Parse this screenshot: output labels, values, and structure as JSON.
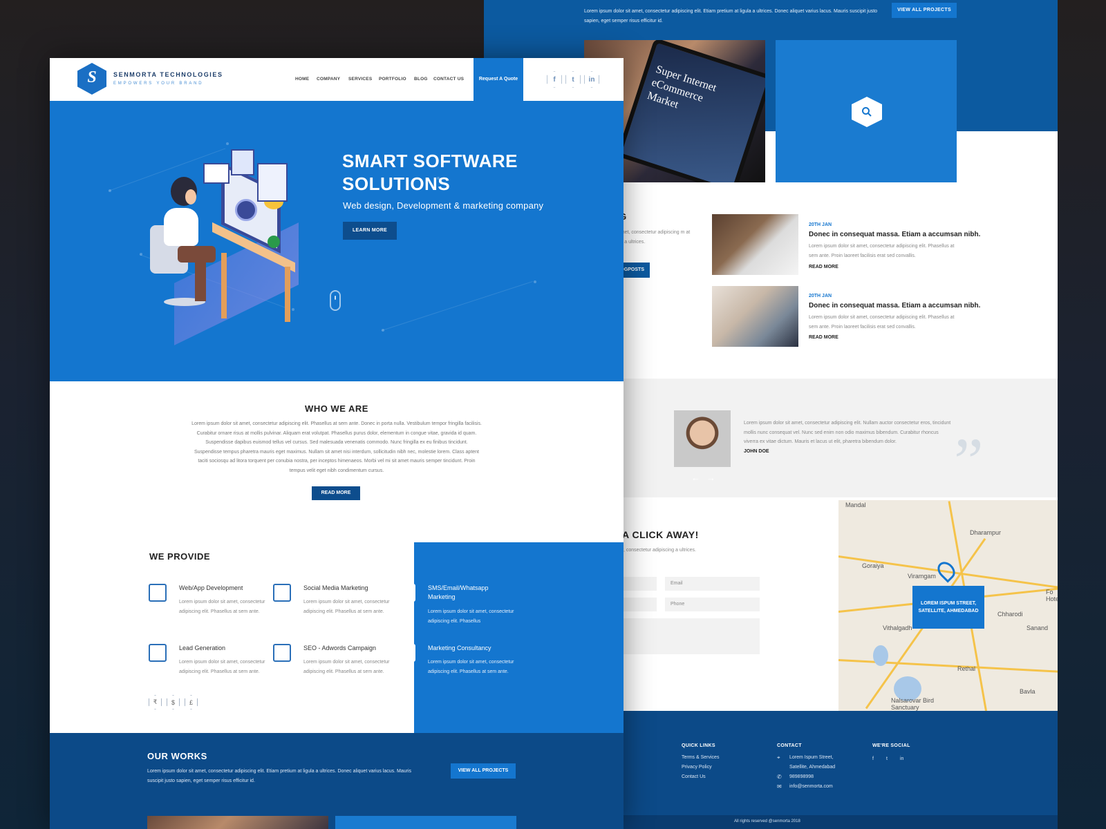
{
  "back": {
    "works_text": "Lorem ipsum dolor sit amet, consectetur adipiscing elit. Etiam pretium at ligula a ultrices. Donec aliquet varius lacus. Mauris suscipit justo sapien, eget semper risus efficitur id.",
    "view_all_projects": "VIEW ALL PROJECTS",
    "project_card_text": "Super Internet eCommerce Market",
    "blog": {
      "heading": "OG",
      "intro": "sit amet, consectetur adipiscing m at ligula a ultrices.",
      "button": "OGPOSTS",
      "posts": [
        {
          "date": "20TH JAN",
          "title": "Donec in consequat massa. Etiam a accumsan nibh.",
          "text": "Lorem ipsum dolor sit amet, consectetur adipiscing elit. Phasellus at sem ante. Proin laoreet facilisis erat sed convallis.",
          "more": "READ MORE"
        },
        {
          "date": "20TH JAN",
          "title": "Donec in consequat massa. Etiam a accumsan nibh.",
          "text": "Lorem ipsum dolor sit amet, consectetur adipiscing elit. Phasellus at sem ante. Proin laoreet facilisis erat sed convallis.",
          "more": "READ MORE"
        }
      ]
    },
    "testimonial": {
      "text": "Lorem ipsum dolor sit amet, consectetur adipiscing elit. Nullam auctor consectetur eros, tincidunt mollis nunc consequat vel. Nunc sed enim non odio maximus bibendum. Curabitur rhoncus viverra ex vitae dictum. Mauris et lacus ut elit, pharetra bibendum dolor.",
      "name": "JOHN DOE",
      "prev": "←",
      "next": "→"
    },
    "contact": {
      "heading": "A CLICK AWAY!",
      "text": "r, consectetur adipiscing a ultrices.",
      "email_placeholder": "Email",
      "phone_placeholder": "Phone"
    },
    "map": {
      "labels": [
        "Mandal",
        "Dharampur",
        "Goraiya",
        "Viramgam",
        "Vithalgadh",
        "Chharodi",
        "Sanand",
        "Rethal",
        "Bavla",
        "Nalsarovar Bird Sanctuary",
        "Fo Hote"
      ],
      "popup_line1": "LOREM ISPUM STREET,",
      "popup_line2": "SATELLITE, AHMEDABAD"
    },
    "footer": {
      "quick_links_heading": "QUICK LINKS",
      "links": [
        "Terms & Services",
        "Privacy Policy",
        "Contact Us"
      ],
      "contact_heading": "CONTACT",
      "address": "Lorem Ispum Street, Satellite, Ahmedabad",
      "phone": "989898998",
      "email": "info@senmorta.com",
      "social_heading": "WE'RE SOCIAL",
      "copyright": "All rights reserved @senmorta 2018"
    }
  },
  "front": {
    "logo": {
      "name": "SENMORTA TECHNOLOGIES",
      "tagline": "EMPOWERS YOUR BRAND",
      "mark": "S"
    },
    "nav": [
      "HOME",
      "COMPANY",
      "SERVICES",
      "PORTFOLIO",
      "BLOG",
      "CONTACT US"
    ],
    "quote_button": "Request A Quote",
    "social": {
      "facebook": "f",
      "twitter": "t",
      "linkedin": "in"
    },
    "hero": {
      "title_line1": "SMART SOFTWARE",
      "title_line2": "SOLUTIONS",
      "subtitle": "Web design, Development & marketing company",
      "button": "LEARN MORE"
    },
    "who": {
      "heading": "WHO WE ARE",
      "text": "Lorem ipsum dolor sit amet, consectetur adipiscing elit. Phasellus at sem ante. Donec in porta nulla. Vestibulum tempor fringilla facilisis. Curabitur ornare risus at mollis pulvinar. Aliquam erat volutpat. Phasellus purus dolor, elementum in congue vitae, gravida id quam. Suspendisse dapibus euismod tellus vel cursus. Sed malesuada venenatis commodo. Nunc fringilla ex eu finibus tincidunt. Suspendisse tempus pharetra mauris eget maximus. Nullam sit amet nisi interdum, sollicitudin nibh nec, molestie lorem. Class aptent taciti sociosqu ad litora torquent per conubia nostra, per inceptos himenaeos. Morbi vel mi sit amet mauris semper tincidunt. Proin tempus velit eget nibh condimentum cursus.",
      "button": "READ MORE"
    },
    "provide": {
      "heading": "WE PROVIDE",
      "services": [
        {
          "title": "Web/App Development",
          "text": "Lorem ipsum dolor sit amet, consectetur adipiscing elit. Phasellus at sem ante."
        },
        {
          "title": "Social Media Marketing",
          "text": "Lorem ipsum dolor sit amet, consectetur adipiscing elit. Phasellus at sem ante."
        },
        {
          "title": "SMS/Email/Whatsapp Marketing",
          "text": "Lorem ipsum dolor sit amet, consectetur adipiscing elit. Phasellus"
        },
        {
          "title": "Lead Generation",
          "text": "Lorem ipsum dolor sit amet, consectetur adipiscing elit. Phasellus at sem ante."
        },
        {
          "title": "SEO - Adwords Campaign",
          "text": "Lorem ipsum dolor sit amet, consectetur adipiscing elit. Phasellus at sem ante."
        },
        {
          "title": "Marketing Consultancy",
          "text": "Lorem ipsum dolor sit amet, consectetur adipiscing elit. Phasellus at sem ante."
        }
      ],
      "currencies": [
        "₹",
        "$",
        "£"
      ]
    },
    "works": {
      "heading": "OUR WORKS",
      "text": "Lorem ipsum dolor sit amet, consectetur adipiscing elit. Etiam pretium at ligula a ultrices. Donec aliquet varius lacus. Mauris suscipit justo sapien, eget semper risus efficitur id.",
      "button": "VIEW ALL PROJECTS"
    }
  }
}
